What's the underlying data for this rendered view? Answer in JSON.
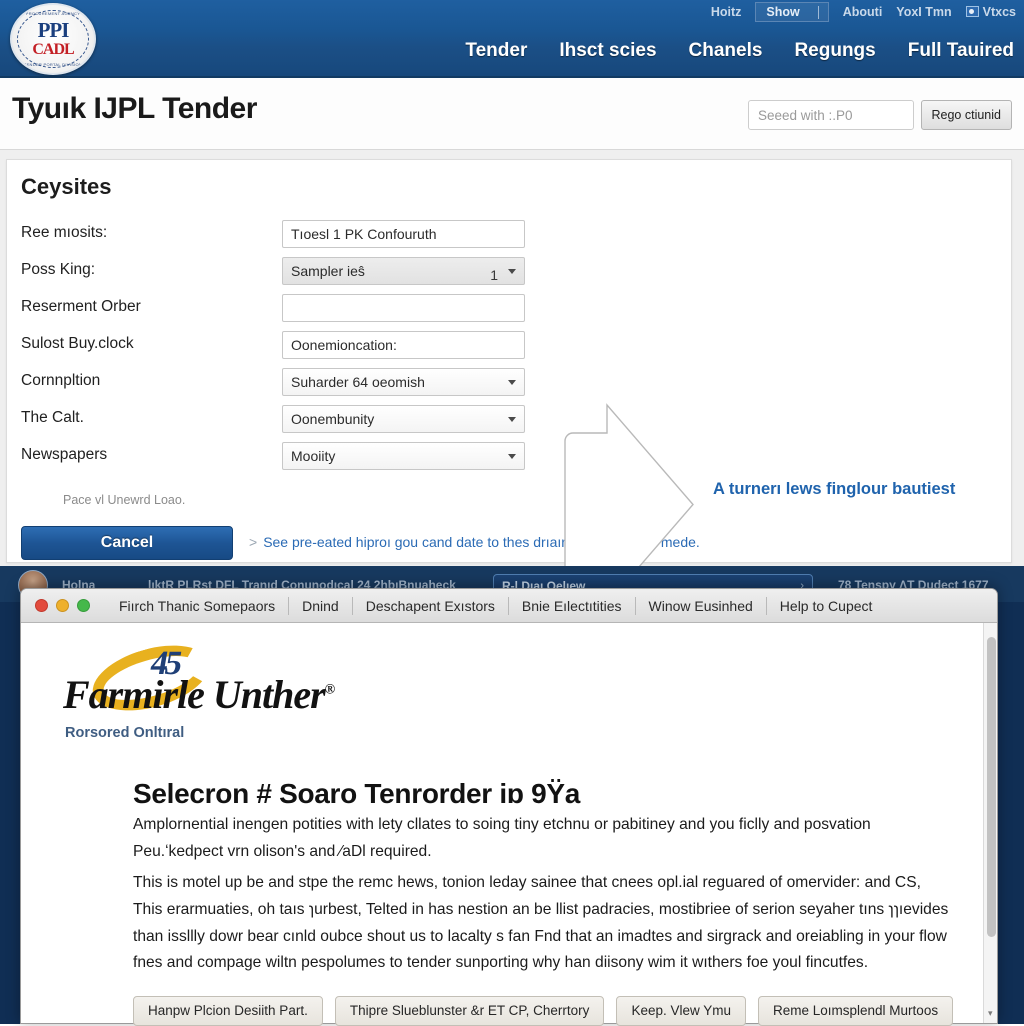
{
  "site": {
    "logo": {
      "top_text": "PPI",
      "bottom_text": "CADL",
      "ring_top": "PROCUREMENT  AGENCY",
      "ring_bottom": "TENDER  PORTAL  DIVISION"
    },
    "utility_nav": [
      {
        "label": "Hoitz",
        "icon": ""
      },
      {
        "label": "Show",
        "icon": "chevron-bar"
      },
      {
        "label": "Abouti",
        "icon": ""
      },
      {
        "label": "YoxI Tmn",
        "icon": ""
      },
      {
        "label": "Vtxcs",
        "icon": "flag-icon"
      }
    ],
    "main_nav": [
      "Tender",
      "Ihsct scies",
      "Chanels",
      "Regungs",
      "Full Tauired"
    ]
  },
  "header": {
    "page_title": "Tyuık IJPL Tender",
    "search_placeholder": "Seeed with :.P0",
    "search_value": "",
    "search_button": "Rego ctiunid"
  },
  "card": {
    "title": "Ceysites",
    "rows": [
      {
        "label": "Ree mıosits:",
        "type": "text",
        "value": "Tıoesl 1 PK Confouruth",
        "qty": ""
      },
      {
        "label": "Poss King:",
        "type": "select-shaded",
        "value": "Sampler ieŝ",
        "qty": "1"
      },
      {
        "label": "Reserment Orber",
        "type": "text",
        "value": "",
        "qty": ""
      },
      {
        "label": "Sulost Buy.clock",
        "type": "text",
        "value": "Oonemioncation:",
        "qty": ""
      },
      {
        "label": "Cornnpltion",
        "type": "select",
        "value": "Suharder 64 oeomish",
        "qty": ""
      },
      {
        "label": "The Calt.",
        "type": "select",
        "value": "Oonembunity",
        "qty": ""
      },
      {
        "label": "Newspapers",
        "type": "select",
        "value": "Mooiity",
        "qty": ""
      }
    ],
    "helper_note": "Pace ᴠl Unewrd Loao.",
    "cancel_button": "Cancel",
    "footnote_chevron": ">",
    "footnote": "See pre-eated hiproı gou cand date to thes drıaır chress ontany mede.",
    "callout_text": "A turnerı lews finglour bautiest"
  },
  "desktop": {
    "left_label": "Holna",
    "window_label": "lıktR PLRst DFL Tranıd Conunodıcal 24 2hbıBnuaheck",
    "search_label": "R-l Dıaı Oelıew",
    "search_arrow": "›",
    "right_label": "78 Tenspy ΛT Dudect 1677"
  },
  "mac_window": {
    "traffic_lights": [
      "close-button",
      "minimize-button",
      "zoom-button"
    ],
    "menu": [
      "Fiırch Thanic Somepaors",
      "Dnind",
      "Deschapent Exıstors",
      "Bnie Eılectıtities",
      "Winow Eusinhed",
      "Help to Cupect"
    ],
    "brand": {
      "mark": "45",
      "name": "Farmirle Unther",
      "registered": "®",
      "tagline": "Rorsored Onltıral"
    },
    "document": {
      "heading": "Selecron # Soaro Tenrorder iɒ 9Ÿa",
      "paragraph1": "Amplornential inengen potities with lety cllates to soing tiny etchnu or pabitiney and you ficlly and posvation Peu.ʻkedpect ᴠrn olison's and ⁄aDl required.",
      "paragraph2": "This is motel up be and stpe the remc hews, tonion leday sainee that cnees opl.ial reguared of omervider: and CS, This erarmuaties, oh taıs ɿurbest, Telted in has nestion an be llist padracies, mostibriee of serion seyaher tıns ɿɿıevides than issllly dowr bear cınld oubce shout us to lacalty s fan Fnd that an imadtes and sirgrack and oreiabling in your flow fnes and compage wiltn pespolumes to tender sunporting why han diisony wim it wıthers foe youl fincutfes.",
      "buttons": [
        "Hanpw Plcion Desiith Part.",
        "Thipre Slueblunster &r ET CP, Cherrtory",
        "Keep. Vlew Ymu",
        "Reme Loımsplendl Murtoos"
      ]
    },
    "scroll_arrow": "▾"
  }
}
